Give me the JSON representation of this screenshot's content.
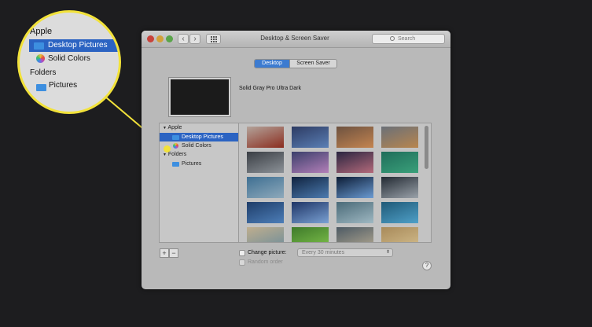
{
  "window": {
    "title": "Desktop & Screen Saver",
    "search_placeholder": "Search",
    "back_symbol": "‹",
    "forward_symbol": "›"
  },
  "tabs": [
    {
      "label": "Desktop",
      "selected": true
    },
    {
      "label": "Screen Saver",
      "selected": false
    }
  ],
  "preview": {
    "name": "Solid Gray Pro Ultra Dark"
  },
  "source_list": {
    "apple_header": "Apple",
    "desktop_pictures": "Desktop Pictures",
    "solid_colors": "Solid Colors",
    "folders_header": "Folders",
    "pictures": "Pictures",
    "disclosure": "▼"
  },
  "thumbnails": [
    {
      "c1": "#b3a39a",
      "c2": "#8b2d1f"
    },
    {
      "c1": "#2d3b63",
      "c2": "#5a7fb5"
    },
    {
      "c1": "#6d5240",
      "c2": "#c48450"
    },
    {
      "c1": "#6a7078",
      "c2": "#b8854e"
    },
    {
      "c1": "#3a3e44",
      "c2": "#8c9298"
    },
    {
      "c1": "#3b3f6b",
      "c2": "#b37fb8"
    },
    {
      "c1": "#2a2540",
      "c2": "#b46a7b"
    },
    {
      "c1": "#1f6d5a",
      "c2": "#3aa07a"
    },
    {
      "c1": "#3e6f92",
      "c2": "#8ea9bb"
    },
    {
      "c1": "#10233f",
      "c2": "#4c7bb0"
    },
    {
      "c1": "#0c1c35",
      "c2": "#6b9bd2"
    },
    {
      "c1": "#232a33",
      "c2": "#9aa2aa"
    },
    {
      "c1": "#1e3d69",
      "c2": "#4d7eb8"
    },
    {
      "c1": "#1f3566",
      "c2": "#7aa1d3"
    },
    {
      "c1": "#4a6a78",
      "c2": "#9fb8c2"
    },
    {
      "c1": "#1f5977",
      "c2": "#4fa0c8"
    },
    {
      "c1": "#bfae8e",
      "c2": "#6f8d9a"
    },
    {
      "c1": "#3e7a2a",
      "c2": "#7ec04b"
    },
    {
      "c1": "#4d5a64",
      "c2": "#b0a690"
    },
    {
      "c1": "#a88a5a",
      "c2": "#d2bc8c"
    }
  ],
  "controls": {
    "add": "+",
    "remove": "−",
    "change_picture_label": "Change picture:",
    "interval_value": "Every 30 minutes",
    "random_order_label": "Random order",
    "help": "?"
  },
  "callout": {
    "apple": "Apple",
    "desktop_pictures": "Desktop Pictures",
    "solid_colors": "Solid Colors",
    "folders": "Folders",
    "pictures": "Pictures",
    "color": "#f2e23a"
  }
}
